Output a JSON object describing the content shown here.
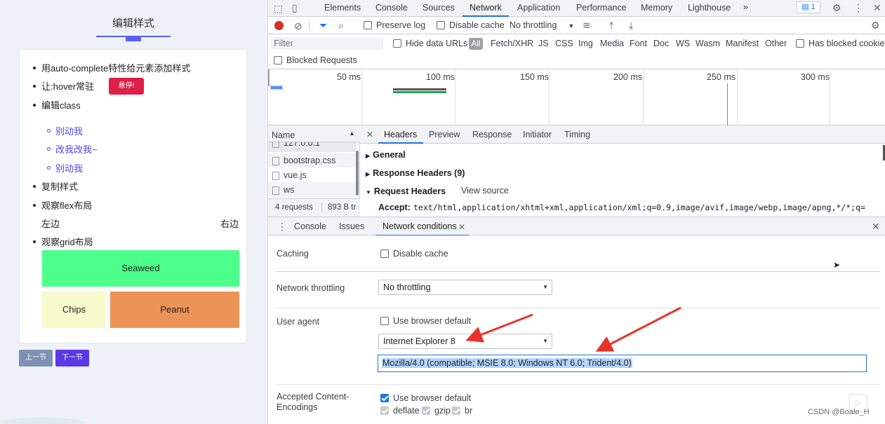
{
  "left": {
    "title": "编辑样式",
    "items": [
      "用auto-complete特性给元素添加样式",
      "让:hover常驻",
      "编辑class",
      "复制样式",
      "观察flex布局",
      "观察grid布局"
    ],
    "hover_button": "悬停!",
    "sub_items": [
      "别动我",
      "改我改我~",
      "别动我"
    ],
    "flex_left": "左边",
    "flex_right": "右边",
    "grid": {
      "seaweed": "Seaweed",
      "chips": "Chips",
      "peanut": "Peanut"
    },
    "prev_button": "上一节",
    "next_button": "下一节",
    "colors": {
      "seaweed": "#4cff8a",
      "chips": "#f9facd",
      "peanut": "#ec9457",
      "hover_btn": "#dc2048",
      "prev": "#7f91b3",
      "next": "#5b39e8"
    }
  },
  "devtools": {
    "tabs": [
      "Elements",
      "Console",
      "Sources",
      "Network",
      "Application",
      "Performance",
      "Memory",
      "Lighthouse"
    ],
    "active_tab": "Network",
    "more": "»",
    "issues_count": "1",
    "toolbar": {
      "preserve_log": "Preserve log",
      "disable_cache": "Disable cache",
      "throttling": "No throttling"
    },
    "filter": {
      "placeholder": "Filter",
      "hide_data_urls": "Hide data URLs",
      "types": [
        "All",
        "Fetch/XHR",
        "JS",
        "CSS",
        "Img",
        "Media",
        "Font",
        "Doc",
        "WS",
        "Wasm",
        "Manifest",
        "Other"
      ],
      "has_blocked_cookies": "Has blocked cookies",
      "blocked_requests": "Blocked Requests"
    },
    "timeline_ticks": [
      "50 ms",
      "100 ms",
      "150 ms",
      "200 ms",
      "250 ms",
      "300 ms"
    ],
    "requests": {
      "name_header": "Name",
      "rows": [
        "127.0.0.1",
        "bootstrap.css",
        "vue.js",
        "ws"
      ],
      "summary_count": "4 requests",
      "summary_size": "893 B tr"
    },
    "detail_tabs": [
      "Headers",
      "Preview",
      "Response",
      "Initiator",
      "Timing"
    ],
    "active_detail_tab": "Headers",
    "headers": {
      "general": "General",
      "response": "Response Headers (9)",
      "request": "Request Headers",
      "view_source": "View source",
      "accept_key": "Accept:",
      "accept_value": "text/html,application/xhtml+xml,application/xml;q=0.9,image/avif,image/webp,image/apng,*/*;q="
    },
    "drawer": {
      "tabs": [
        "Console",
        "Issues",
        "Network conditions"
      ],
      "active": "Network conditions",
      "caching_label": "Caching",
      "disable_cache": "Disable cache",
      "throttling_label": "Network throttling",
      "throttling_value": "No throttling",
      "ua_label": "User agent",
      "use_default": "Use browser default",
      "ua_select": "Internet Explorer 8",
      "ua_string": "Mozilla/4.0 (compatible; MSIE 8.0; Windows NT 6.0; Trident/4.0)",
      "encodings_label": "Accepted Content-Encodings",
      "enc_default": "Use browser default",
      "enc": [
        "deflate",
        "gzip",
        "br"
      ]
    },
    "watermark": "CSDN @Boale_H"
  }
}
